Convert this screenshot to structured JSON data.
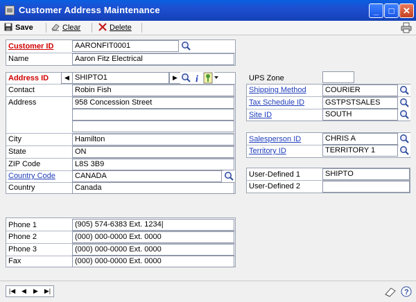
{
  "window": {
    "title": "Customer Address Maintenance",
    "min": "_",
    "max": "□",
    "close": "✕"
  },
  "toolbar": {
    "save": "Save",
    "clear": "Clear",
    "delete": "Delete"
  },
  "left": {
    "customer_id_label": "Customer ID",
    "customer_id": "AARONFIT0001",
    "name_label": "Name",
    "name": "Aaron Fitz Electrical",
    "address_id_label": "Address ID",
    "address_id": "SHIPTO1",
    "contact_label": "Contact",
    "contact": "Robin Fish",
    "address_label": "Address",
    "address1": "958 Concession Street",
    "address2": "",
    "address3": "",
    "city_label": "City",
    "city": "Hamilton",
    "state_label": "State",
    "state": "ON",
    "zip_label": "ZIP Code",
    "zip": "L8S 3B9",
    "country_code_label": "Country Code",
    "country_code": "CANADA",
    "country_label": "Country",
    "country": "Canada"
  },
  "phones": {
    "phone1_label": "Phone 1",
    "phone1": "(905) 574-6383  Ext. 1234|",
    "phone2_label": "Phone 2",
    "phone2": "(000) 000-0000  Ext. 0000",
    "phone3_label": "Phone 3",
    "phone3": "(000) 000-0000  Ext. 0000",
    "fax_label": "Fax",
    "fax": "(000) 000-0000  Ext. 0000"
  },
  "right": {
    "ups_zone_label": "UPS Zone",
    "ups_zone": "",
    "shipping_method_label": "Shipping Method",
    "shipping_method": "COURIER",
    "tax_schedule_label": "Tax Schedule ID",
    "tax_schedule": "GSTPSTSALES",
    "site_id_label": "Site ID",
    "site_id": "SOUTH",
    "salesperson_label": "Salesperson ID",
    "salesperson": "CHRIS A",
    "territory_label": "Territory ID",
    "territory": "TERRITORY 1",
    "user_def1_label": "User-Defined 1",
    "user_def1": "SHIPTO",
    "user_def2_label": "User-Defined 2",
    "user_def2": ""
  },
  "icons": {
    "lookup": "magnifier-icon",
    "info": "info-icon",
    "note": "note-icon",
    "print": "printer-icon"
  },
  "colors": {
    "title_bar": "#1d4fd0",
    "link": "#1f3dbb",
    "required": "#d00000"
  }
}
